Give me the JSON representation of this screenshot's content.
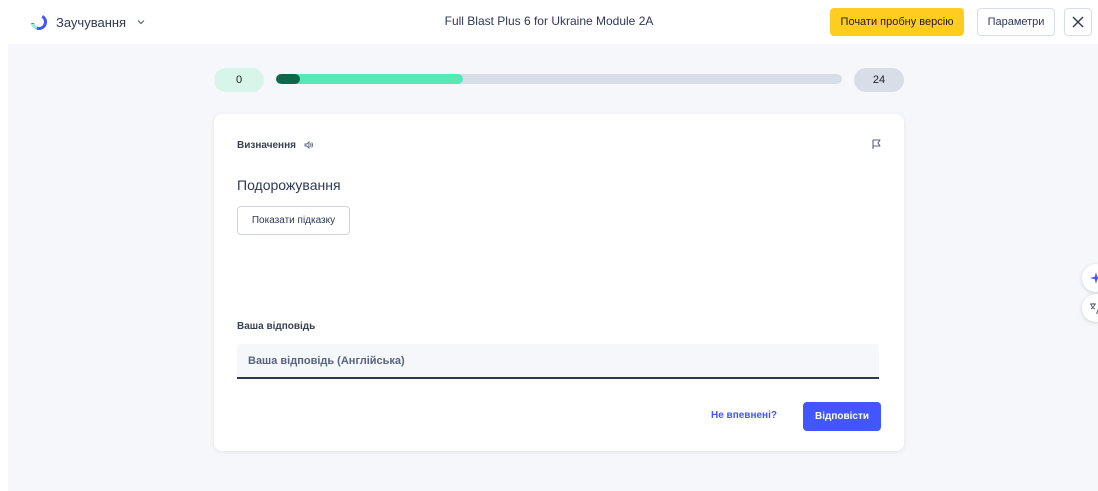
{
  "header": {
    "mode_label": "Заучування",
    "title": "Full Blast Plus 6 for Ukraine Module 2A",
    "trial_button": "Почати пробну версію",
    "options_button": "Параметри",
    "icons": [
      "learn-mode-icon",
      "chevron-down-icon",
      "close-icon"
    ]
  },
  "progress": {
    "known_count": "0",
    "total_count": "24",
    "fraction": 0.33
  },
  "card": {
    "section_label": "Визначення",
    "term": "Подорожування",
    "hint_button": "Показати підказку",
    "answer_label": "Ваша відповідь",
    "answer_placeholder": "Ваша відповідь (Англійська)",
    "answer_value": "",
    "unsure_link": "Не впевнені?",
    "answer_button": "Відповісти",
    "icons": [
      "audio-icon",
      "flag-icon"
    ]
  },
  "floating": {
    "icons": [
      "ai-sparkle-icon",
      "translate-icon"
    ]
  },
  "colors": {
    "accent": "#4255ff",
    "trial": "#ffcd1f",
    "progress": "#59e8b5",
    "progress_knob": "#12674a",
    "background": "#f6f7fb"
  }
}
